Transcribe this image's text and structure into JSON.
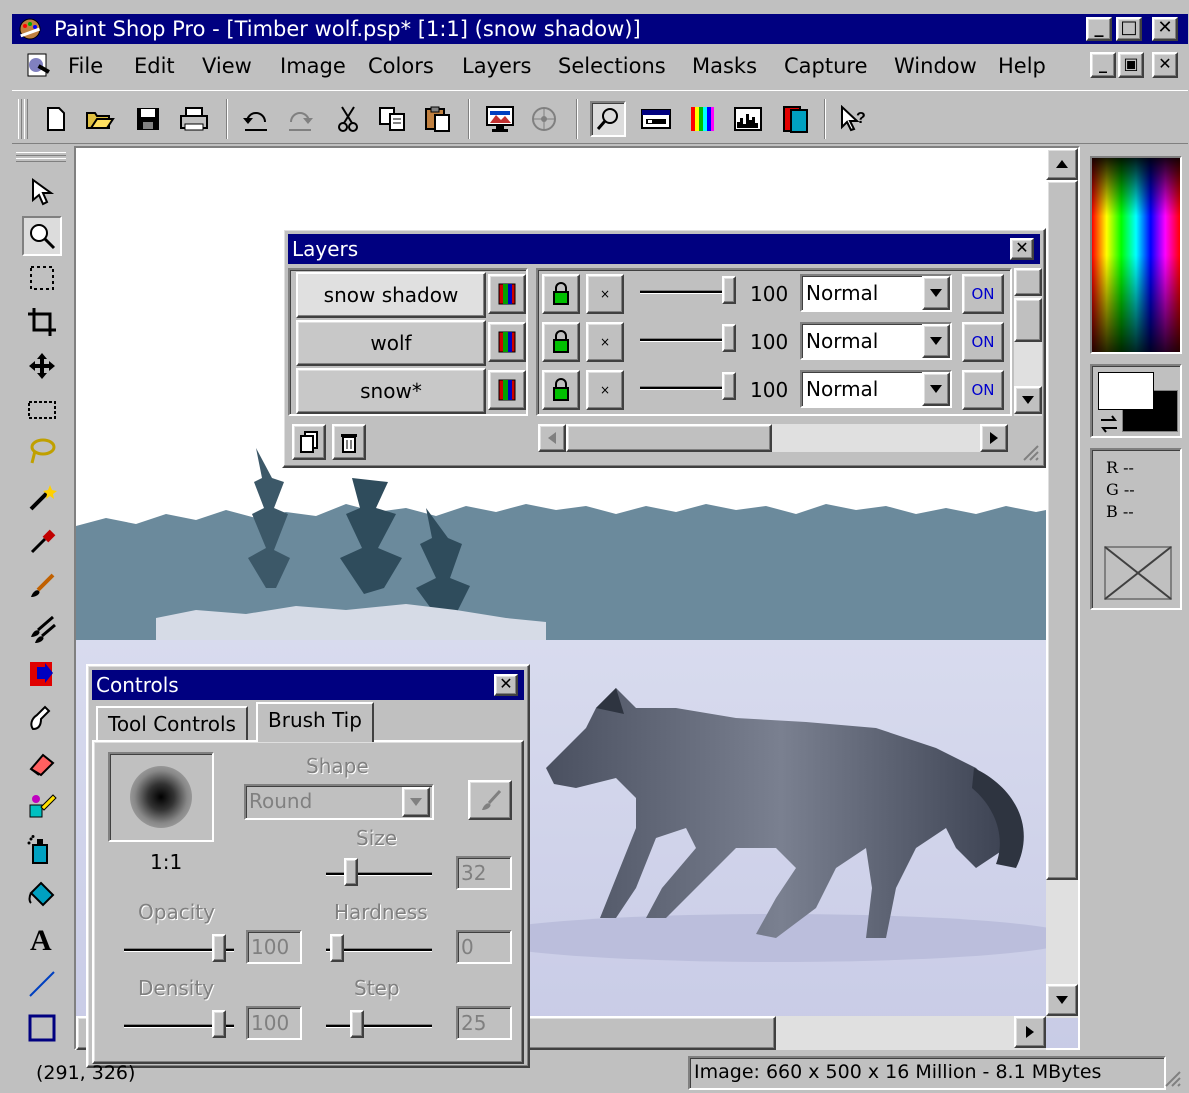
{
  "window": {
    "title": "Paint Shop Pro - [Timber wolf.psp* [1:1] (snow shadow)]",
    "caption_buttons": [
      "minimize-icon",
      "maximize-icon",
      "close-icon"
    ]
  },
  "menu": {
    "items": [
      {
        "label": "File"
      },
      {
        "label": "Edit"
      },
      {
        "label": "View"
      },
      {
        "label": "Image"
      },
      {
        "label": "Colors"
      },
      {
        "label": "Layers"
      },
      {
        "label": "Selections"
      },
      {
        "label": "Masks"
      },
      {
        "label": "Capture"
      },
      {
        "label": "Window"
      },
      {
        "label": "Help"
      }
    ]
  },
  "toolbar": {
    "buttons": [
      "new-icon",
      "open-icon",
      "save-icon",
      "print-icon",
      "undo-icon",
      "redo-icon",
      "cut-icon",
      "copy-icon",
      "paste-icon",
      "full-screen-preview-icon",
      "browse-icon",
      "overview-icon",
      "toggle-controls-icon",
      "toggle-color-palette-icon",
      "histogram-icon",
      "layer-palette-icon",
      "context-help-icon"
    ]
  },
  "tools": [
    "arrow-icon",
    "zoom-icon",
    "selection-icon",
    "crop-icon",
    "mover-icon",
    "rectangle-select-icon",
    "freehand-select-icon",
    "magic-wand-icon",
    "dropper-icon",
    "paintbrush-icon",
    "clone-brush-icon",
    "color-replacer-icon",
    "retouch-icon",
    "eraser-icon",
    "picture-tube-icon",
    "airbrush-icon",
    "flood-fill-icon",
    "text-icon",
    "line-icon",
    "shape-icon"
  ],
  "layers_panel": {
    "title": "Layers",
    "layers": [
      {
        "name": "snow shadow",
        "opacity": "100",
        "blend": "Normal",
        "visible": "ON"
      },
      {
        "name": "wolf",
        "opacity": "100",
        "blend": "Normal",
        "visible": "ON"
      },
      {
        "name": "snow*",
        "opacity": "100",
        "blend": "Normal",
        "visible": "ON"
      }
    ]
  },
  "controls_panel": {
    "title": "Controls",
    "tabs": [
      {
        "label": "Tool Controls"
      },
      {
        "label": "Brush Tip"
      }
    ],
    "zoom_label": "1:1",
    "shape_label": "Shape",
    "shape_value": "Round",
    "size_label": "Size",
    "size_value": "32",
    "opacity_label": "Opacity",
    "opacity_value": "100",
    "hardness_label": "Hardness",
    "hardness_value": "0",
    "density_label": "Density",
    "density_value": "100",
    "step_label": "Step",
    "step_value": "25"
  },
  "color_palette": {
    "rgb_r": "R --",
    "rgb_g": "G --",
    "rgb_b": "B --",
    "foreground": "#ffffff",
    "background": "#000000"
  },
  "status": {
    "cursor": "(291, 326)",
    "image_info": "Image:  660 x 500 x 16 Million - 8.1 MBytes"
  }
}
